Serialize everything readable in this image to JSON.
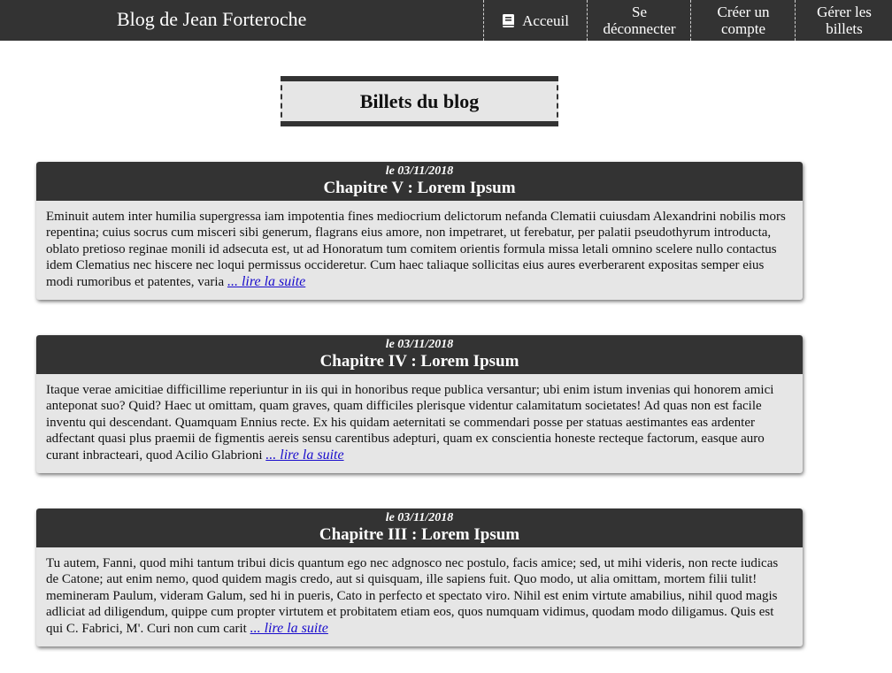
{
  "navbar": {
    "brand": "Blog de Jean Forteroche",
    "items": [
      {
        "label": "Acceuil",
        "icon": "book-icon"
      },
      {
        "label_line1": "Se",
        "label_line2": "déconnecter"
      },
      {
        "label_line1": "Créer un",
        "label_line2": "compte"
      },
      {
        "label_line1": "Gérer les",
        "label_line2": "billets"
      }
    ]
  },
  "page": {
    "title": "Billets du blog"
  },
  "posts": [
    {
      "date": "le 03/11/2018",
      "title": "Chapitre V : Lorem Ipsum",
      "excerpt": "Eminuit autem inter humilia supergressa iam impotentia fines mediocrium delictorum nefanda Clematii cuiusdam Alexandrini nobilis mors repentina; cuius socrus cum misceri sibi generum, flagrans eius amore, non impetraret, ut ferebatur, per palatii pseudothyrum introducta, oblato pretioso reginae monili id adsecuta est, ut ad Honoratum tum comitem orientis formula missa letali omnino scelere nullo contactus idem Clematius nec hiscere nec loqui permissus occideretur.   Cum haec taliaque sollicitas eius aures everberarent expositas semper eius modi rumoribus et patentes, varia",
      "read_more": "... lire la suite"
    },
    {
      "date": "le 03/11/2018",
      "title": "Chapitre IV : Lorem Ipsum",
      "excerpt": "Itaque verae amicitiae difficillime reperiuntur in iis qui in honoribus reque publica versantur; ubi enim istum invenias qui honorem amici anteponat suo? Quid? Haec ut omittam, quam graves, quam difficiles plerisque videntur calamitatum societates! Ad quas non est facile inventu qui descendant. Quamquam Ennius recte.   Ex his quidam aeternitati se commendari posse per statuas aestimantes eas ardenter adfectant quasi plus praemii de figmentis aereis sensu carentibus adepturi, quam ex conscientia honeste recteque factorum, easque auro curant inbracteari, quod Acilio Glabrioni",
      "read_more": "... lire la suite"
    },
    {
      "date": "le 03/11/2018",
      "title": "Chapitre III : Lorem Ipsum",
      "excerpt": "Tu autem, Fanni, quod mihi tantum tribui dicis quantum ego nec adgnosco nec postulo, facis amice; sed, ut mihi videris, non recte iudicas de Catone; aut enim nemo, quod quidem magis credo, aut si quisquam, ille sapiens fuit. Quo modo, ut alia omittam, mortem filii tulit! memineram Paulum, videram Galum, sed hi in pueris, Cato in perfecto et spectato viro.   Nihil est enim virtute amabilius, nihil quod magis adliciat ad diligendum, quippe cum propter virtutem et probitatem etiam eos, quos numquam vidimus, quodam modo diligamus. Quis est qui C. Fabrici, M'. Curi non cum carit",
      "read_more": "... lire la suite"
    }
  ],
  "colors": {
    "dark": "#333333",
    "panel": "#e6e6e6",
    "link": "#1a0dcc"
  }
}
